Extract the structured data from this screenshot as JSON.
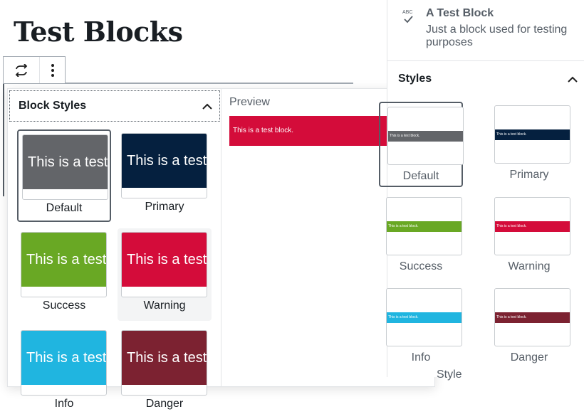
{
  "page": {
    "title": "Test Blocks"
  },
  "toolbar": {
    "transform_icon": "transform-arrows-icon",
    "more_icon": "vertical-ellipsis-icon"
  },
  "popover": {
    "styles_title": "Block Styles",
    "preview_label": "Preview",
    "preview_text": "This is a test block.",
    "preview_color": "#d40c3a",
    "thumb_text": "This is a test block.",
    "styles": [
      {
        "label": "Default",
        "color": "#636569",
        "active": true
      },
      {
        "label": "Primary",
        "color": "#05203f",
        "active": false
      },
      {
        "label": "Success",
        "color": "#69a824",
        "active": false
      },
      {
        "label": "Warning",
        "color": "#d40c3a",
        "active": false,
        "hovered": true
      },
      {
        "label": "Info",
        "color": "#20b5e0",
        "active": false
      },
      {
        "label": "Danger",
        "color": "#7c2231",
        "active": false
      }
    ]
  },
  "sidebar": {
    "block_icon": "abc-spellcheck-icon",
    "block_icon_text": "ABC",
    "block_name": "A Test Block",
    "block_description": "Just a block used for testing purposes",
    "styles_title": "Styles",
    "stripe_text": "This is a test block.",
    "items": [
      {
        "label": "Default",
        "color": "#636569",
        "active": true
      },
      {
        "label": "Primary",
        "color": "#05203f",
        "active": false
      },
      {
        "label": "Success",
        "color": "#69a824",
        "active": false
      },
      {
        "label": "Warning",
        "color": "#d40c3a",
        "active": false
      },
      {
        "label": "Info",
        "color": "#20b5e0",
        "active": false
      },
      {
        "label": "Danger",
        "color": "#7c2231",
        "active": false
      }
    ],
    "next_item_label": "Style"
  }
}
